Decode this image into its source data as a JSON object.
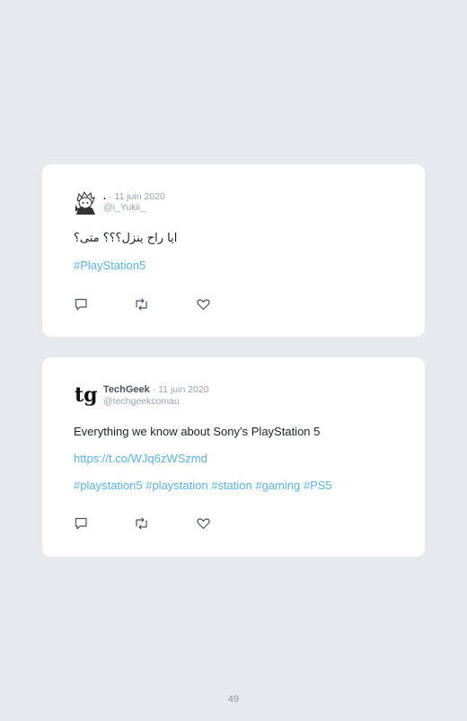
{
  "tweets": [
    {
      "name": ".",
      "separator": " · ",
      "date": "11 juin 2020",
      "handle": "@i_Yukii_",
      "text": "ايا راح ينزل؟؟؟ متى؟",
      "hashtags": "#PlayStation5",
      "avatar_icon": "anime-avatar-icon"
    },
    {
      "name": "TechGeek",
      "separator": " · ",
      "date": "11 juin 2020",
      "handle": "@techgeekcomau",
      "text": "Everything we know about Sony’s PlayStation 5",
      "link": "https://t.co/WJq6zWSzmd",
      "hashtags": "#playstation5 #playstation #station #gaming #PS5",
      "avatar_icon": "tg-logo-icon"
    }
  ],
  "action_icons": [
    "reply-icon",
    "retweet-icon",
    "like-icon"
  ],
  "colors": {
    "background": "#e6e9ee",
    "card": "#ffffff",
    "link": "#5ab4e6",
    "muted": "#9aa3ad"
  },
  "page_number": "49"
}
